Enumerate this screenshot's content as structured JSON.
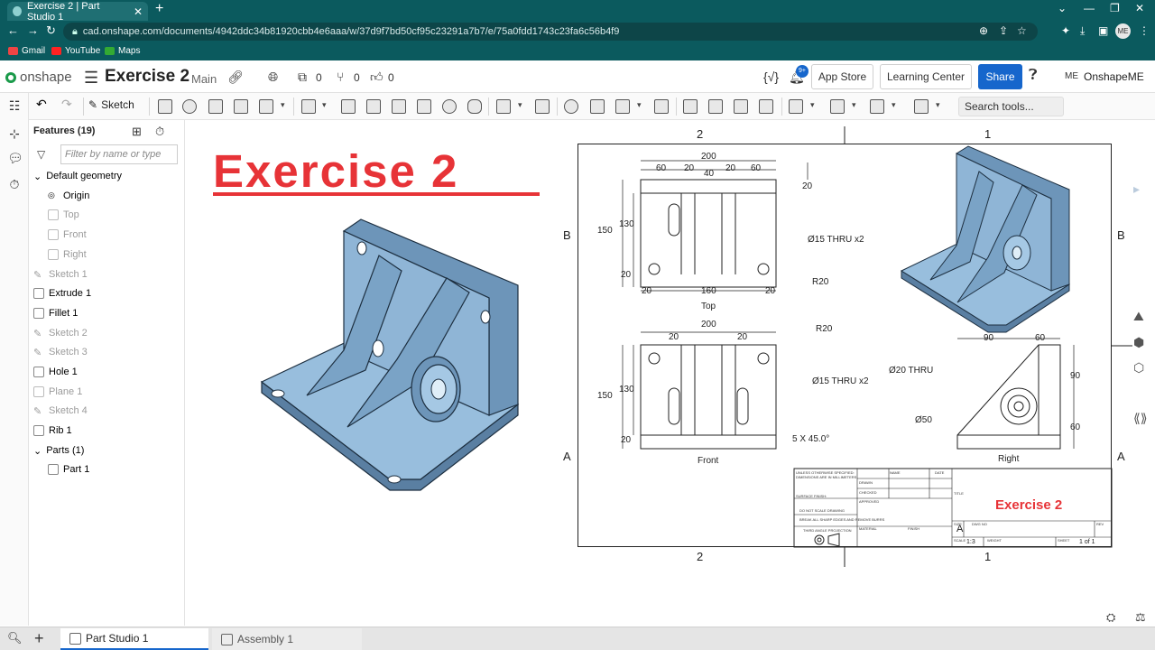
{
  "browser": {
    "tab_title": "Exercise 2 | Part Studio 1",
    "url": "cad.onshape.com/documents/4942ddc34b81920cbb4e6aaa/w/37d9f7bd50cf95c23291a7b7/e/75a0fdd1743c23fa6c56b4f9",
    "bookmarks": [
      "Gmail",
      "YouTube",
      "Maps"
    ],
    "profile_initials": "ME"
  },
  "app": {
    "brand": "onshape",
    "doc_title": "Exercise 2",
    "branch": "Main",
    "versions_count": "0",
    "branches_count": "0",
    "likes_count": "0",
    "notif_count": "9+",
    "buttons": {
      "app_store": "App Store",
      "learning_center": "Learning Center",
      "share": "Share"
    },
    "user_name": "OnshapeME",
    "user_initials": "ME"
  },
  "toolbar": {
    "sketch_label": "Sketch",
    "search_placeholder": "Search tools...",
    "search_kbd_1": "alt",
    "search_kbd_2": "C"
  },
  "features": {
    "title": "Features (19)",
    "filter_placeholder": "Filter by name or type",
    "items": [
      {
        "label": "Default geometry",
        "kind": "group"
      },
      {
        "label": "Origin",
        "kind": "origin"
      },
      {
        "label": "Top",
        "kind": "plane",
        "dim": true
      },
      {
        "label": "Front",
        "kind": "plane",
        "dim": true
      },
      {
        "label": "Right",
        "kind": "plane",
        "dim": true
      },
      {
        "label": "Sketch 1",
        "kind": "sketch",
        "dim": true
      },
      {
        "label": "Extrude 1",
        "kind": "extrude"
      },
      {
        "label": "Fillet 1",
        "kind": "fillet"
      },
      {
        "label": "Sketch 2",
        "kind": "sketch",
        "dim": true
      },
      {
        "label": "Sketch 3",
        "kind": "sketch",
        "dim": true
      },
      {
        "label": "Hole 1",
        "kind": "hole"
      },
      {
        "label": "Plane 1",
        "kind": "plane",
        "dim": true
      },
      {
        "label": "Sketch 4",
        "kind": "sketch",
        "dim": true
      },
      {
        "label": "Rib 1",
        "kind": "rib"
      }
    ],
    "parts_title": "Parts (1)",
    "parts": [
      "Part 1"
    ]
  },
  "viewport": {
    "heading": "Exercise 2"
  },
  "drawing": {
    "zones": {
      "top_left": "2",
      "top_right": "1",
      "bottom_left": "2",
      "bottom_right": "1",
      "row_b": "B",
      "row_a": "A"
    },
    "top_view": {
      "caption": "Top",
      "dims": {
        "overall_width": "200",
        "seg_left": "60",
        "seg_20a": "20",
        "seg_40": "40",
        "seg_20b": "20",
        "seg_right": "60",
        "thk": "20",
        "height": "150",
        "inner_h": "130",
        "bottom_20": "20",
        "left_20": "20",
        "mid_160": "160",
        "right_20": "20",
        "hole_note": "Ø15 THRU x2",
        "radius": "R20"
      }
    },
    "front_view": {
      "caption": "Front",
      "dims": {
        "overall_width": "200",
        "left_20": "20",
        "right_20": "20",
        "height": "150",
        "inner_h": "130",
        "bottom_20": "20",
        "radius": "R20",
        "hole_note": "Ø15 THRU x2",
        "chamfer": "5 X 45.0°"
      }
    },
    "right_view": {
      "caption": "Right",
      "dims": {
        "w90": "90",
        "w60": "60",
        "h90": "90",
        "h60": "60",
        "bore": "Ø20 THRU",
        "boss": "Ø50"
      }
    },
    "title_block": {
      "title": "Exercise 2",
      "size": "A",
      "scale": "1:3",
      "sheet": "1 of 1",
      "notes": [
        "UNLESS OTHERWISE SPECIFIED:",
        "DIMENSIONS ARE IN MILLIMETERS",
        "SURFACE FINISH:",
        "DO NOT SCALE DRAWING",
        "BREAK ALL SHARP EDGES AND REMOVE BURRS",
        "THIRD ANGLE PROJECTION"
      ],
      "fields": [
        "NAME",
        "DATE",
        "DRAWN",
        "CHECKED",
        "APPROVED",
        "MATERIAL",
        "FINISH",
        "TITLE",
        "SIZE",
        "DWG NO",
        "REV",
        "SCALE",
        "WEIGHT",
        "SHEET"
      ]
    }
  },
  "tabs": [
    {
      "label": "Part Studio 1",
      "active": true
    },
    {
      "label": "Assembly 1",
      "active": false
    }
  ]
}
